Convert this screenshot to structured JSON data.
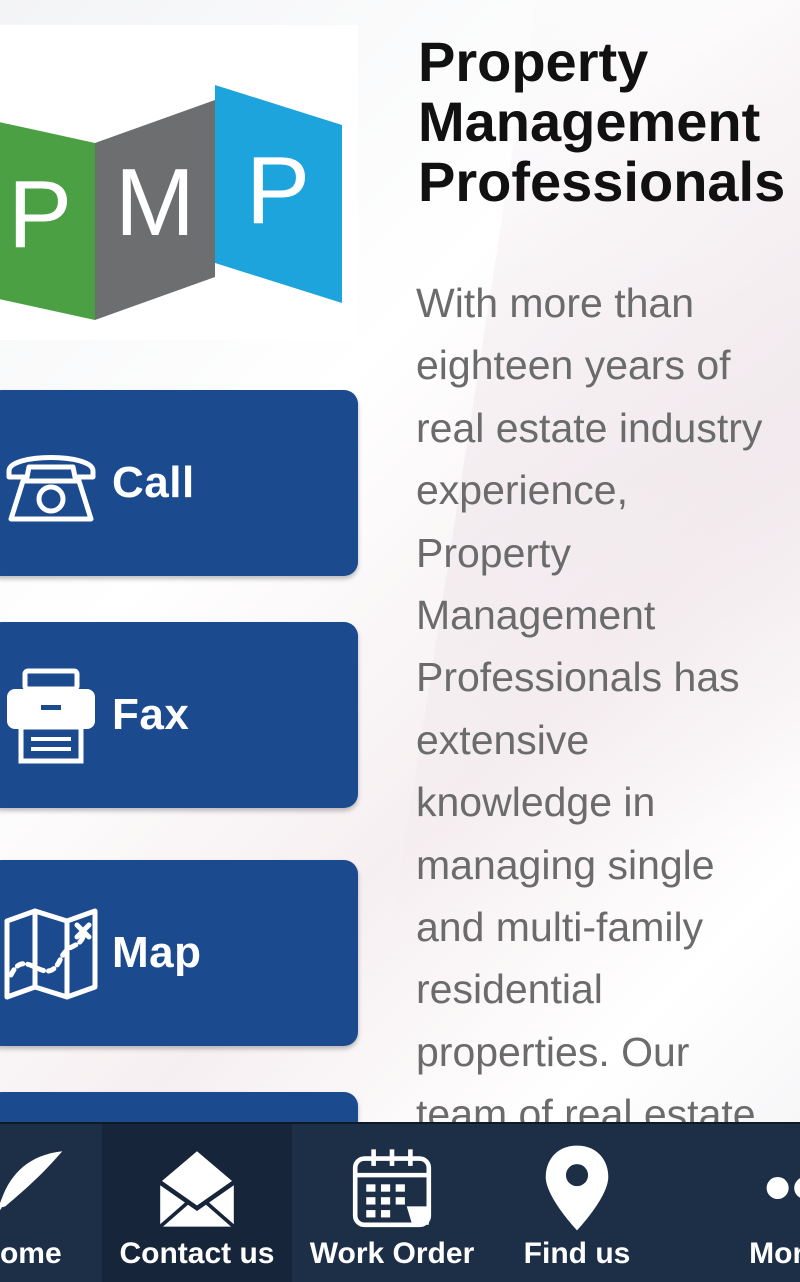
{
  "logo": {
    "letters": [
      "P",
      "M",
      "P"
    ],
    "colors": [
      "#4aa043",
      "#6d6e70",
      "#1ea4dc"
    ]
  },
  "header": {
    "title_lines": [
      "Property",
      "Management",
      "Professionals"
    ]
  },
  "description_lines": [
    "With more than",
    "eighteen years of",
    "real estate industry",
    "experience,",
    "Property",
    "Management",
    "Professionals has",
    "extensive",
    "knowledge in",
    "managing single",
    "and multi-family",
    "residential",
    "properties. Our",
    "team of real estate"
  ],
  "actions": [
    {
      "label": "Call",
      "icon": "telephone-icon"
    },
    {
      "label": "Fax",
      "icon": "fax-icon"
    },
    {
      "label": "Map",
      "icon": "map-icon"
    }
  ],
  "bottom_nav": {
    "items": [
      {
        "label": "Home",
        "icon": "feather-icon"
      },
      {
        "label": "Contact us",
        "icon": "envelope-icon"
      },
      {
        "label": "Work Order",
        "icon": "calendar-icon"
      },
      {
        "label": "Find us",
        "icon": "location-pin-icon"
      },
      {
        "label": "More",
        "icon": "more-dots-icon"
      }
    ]
  },
  "colors": {
    "button_blue": "#1b4a8f",
    "nav_bg": "#1d2f47",
    "nav_active": "#17253a",
    "title": "#111111",
    "body_text": "#6b6b6b"
  }
}
